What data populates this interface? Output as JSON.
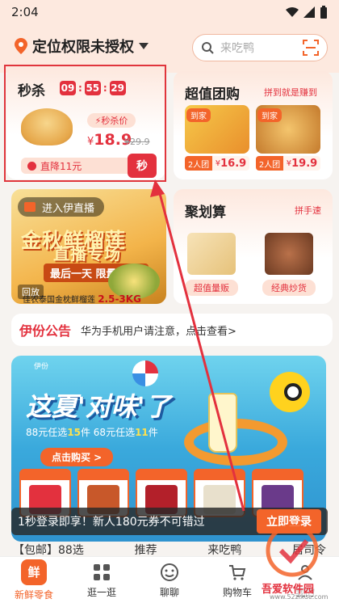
{
  "status_bar": {
    "time": "2:04"
  },
  "header": {
    "location": "定位权限未授权",
    "search_placeholder": "来吃鸭"
  },
  "flash_sale": {
    "title": "秒杀",
    "timer": [
      "09",
      "55",
      "29"
    ],
    "tag": "秒杀价",
    "price_symbol": "¥",
    "price": "18.9",
    "old_price": "¥29.9",
    "discount": "直降11元",
    "button": "秒"
  },
  "group_buy": {
    "title": "超值团购",
    "subtitle": "拼到就是赚到",
    "items": [
      {
        "badge": "到家",
        "group": "2人团",
        "price": "16.9"
      },
      {
        "badge": "到家",
        "group": "2人团",
        "price": "19.9"
      }
    ]
  },
  "live": {
    "pill": "进入伊直播",
    "headline": "金秋鲜榴莲",
    "sub_headline": "直播专场",
    "promo": "最后一天 限量20个",
    "replay": "回放",
    "footer": "佳农泰国金枕鲜榴莲",
    "footer_weight": "2.5-3KG"
  },
  "juhuasuan": {
    "title": "聚划算",
    "subtitle": "拼手速",
    "items": [
      {
        "label": "超值量贩"
      },
      {
        "label": "经典炒货"
      }
    ]
  },
  "notice": {
    "title": "伊份公告",
    "text": "华为手机用户请注意，点击查看>"
  },
  "banner": {
    "brand": "伊份",
    "title": "这夏'对味'了",
    "sub_a": "88元任选",
    "sub_a_hl": "15",
    "sub_b": "件  68元任选",
    "sub_b_hl": "11",
    "sub_c": "件",
    "cta": "点击购买 >"
  },
  "login_prompt": {
    "text": "1秒登录即享！新人180元券不可错过",
    "button": "立即登录"
  },
  "category_tabs": [
    "【包邮】88选",
    "推荐",
    "来吃鸭",
    "居司令"
  ],
  "bottom_nav": [
    {
      "label": "新鲜零食",
      "icon_text": "鲜"
    },
    {
      "label": "逛一逛"
    },
    {
      "label": "聊聊"
    },
    {
      "label": "购物车"
    },
    {
      "label": "我的"
    }
  ],
  "watermark": {
    "text": "吾爱软件园",
    "url": "www.52zixue.com"
  },
  "colors": {
    "accent": "#f3642a",
    "sale_red": "#e3313e",
    "highlight": "#e0353c"
  }
}
